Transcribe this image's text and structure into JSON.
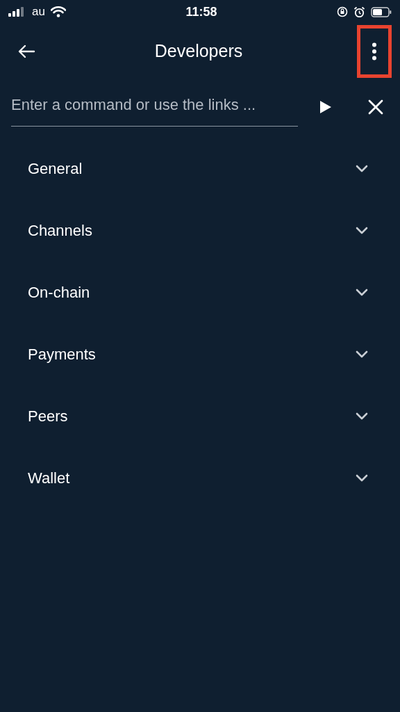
{
  "status_bar": {
    "carrier": "au",
    "time": "11:58"
  },
  "header": {
    "title": "Developers",
    "menu_highlighted": true
  },
  "command": {
    "placeholder": "Enter a command or use the links ..."
  },
  "sections": [
    {
      "label": "General",
      "expanded": false
    },
    {
      "label": "Channels",
      "expanded": false
    },
    {
      "label": "On-chain",
      "expanded": false
    },
    {
      "label": "Payments",
      "expanded": false
    },
    {
      "label": "Peers",
      "expanded": false
    },
    {
      "label": "Wallet",
      "expanded": false
    }
  ]
}
